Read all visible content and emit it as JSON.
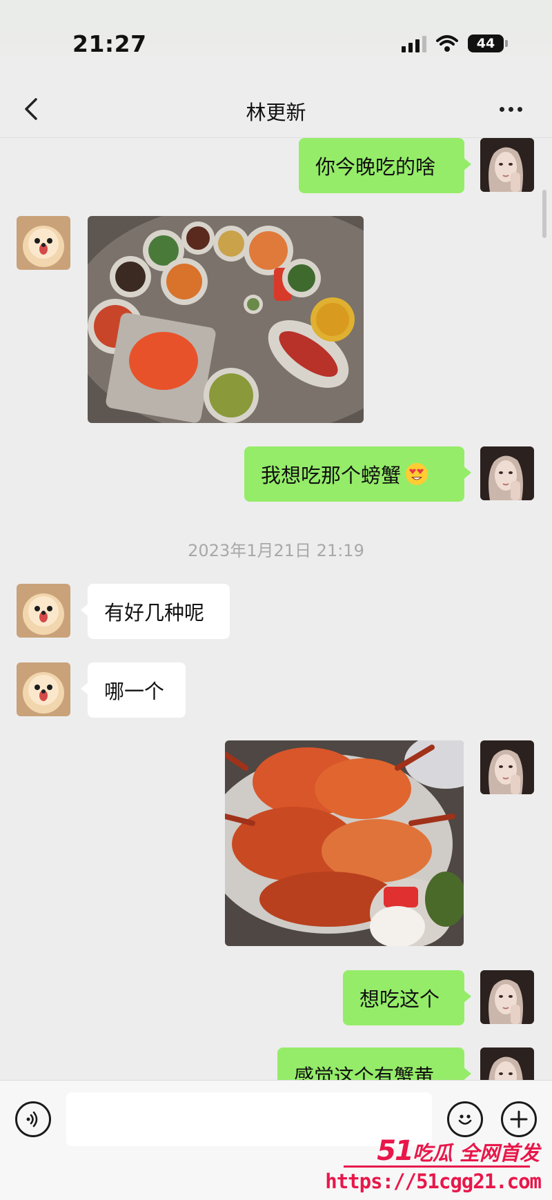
{
  "status_bar": {
    "time": "21:27",
    "battery": "44"
  },
  "nav": {
    "title": "林更新"
  },
  "messages": [
    {
      "text": "你今晚吃的啥"
    },
    {
      "text": "我想吃那个螃蟹"
    },
    {
      "text": "有好几种呢"
    },
    {
      "text": "哪一个"
    },
    {
      "text": "想吃这个"
    },
    {
      "text": "感觉这个有蟹黄"
    }
  ],
  "timestamp": "2023年1月21日 21:19",
  "watermark": {
    "line1_num": "51",
    "line1_text": "吃瓜 全网首发",
    "line2": "https://51cgg21.com"
  },
  "colors": {
    "my_bubble": "#95ec69",
    "their_bubble": "#ffffff",
    "background": "#ededed",
    "watermark": "#e8174a"
  },
  "icons": [
    "back-icon",
    "more-icon",
    "voice-icon",
    "emoji-icon",
    "plus-icon",
    "heart-eyes-emoji"
  ]
}
